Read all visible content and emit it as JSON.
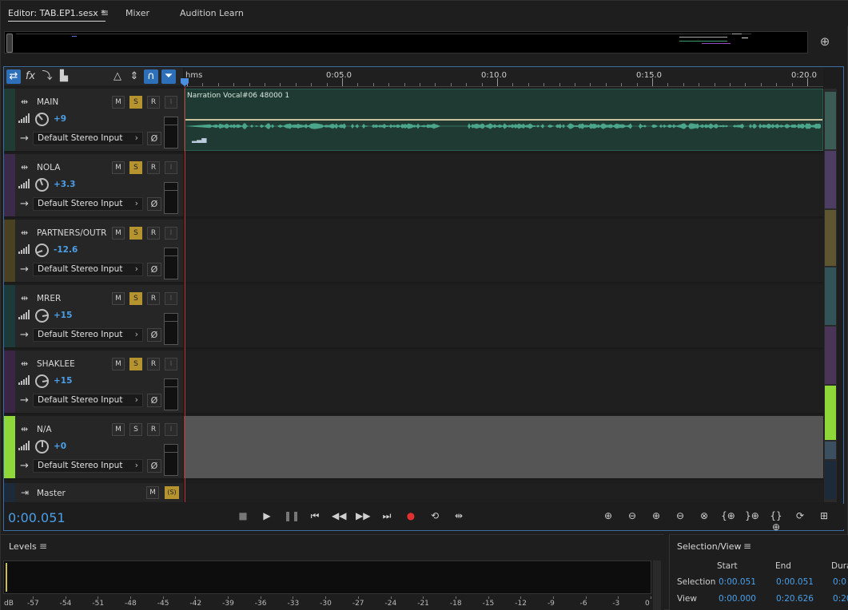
{
  "tabs": {
    "editor": "Editor: TAB.EP1.sesx *",
    "mixer": "Mixer",
    "learn": "Audition Learn"
  },
  "ruler": {
    "unit": "hms",
    "labels": [
      "0:05.0",
      "0:10.0",
      "0:15.0",
      "0:20.0"
    ]
  },
  "clip": {
    "title": "Narration Vocal#06 48000 1"
  },
  "tracks": [
    {
      "name": "MAIN",
      "volume": "+9",
      "input": "Default Stereo Input",
      "color": "#1f3b34",
      "solo": true,
      "knob_deg": -40
    },
    {
      "name": "NOLA",
      "volume": "+3.3",
      "input": "Default Stereo Input",
      "color": "#3b2a4a",
      "solo": true,
      "knob_deg": -20
    },
    {
      "name": "PARTNERS/OUTR",
      "volume": "-12.6",
      "input": "Default Stereo Input",
      "color": "#4a4120",
      "solo": true,
      "knob_deg": -110
    },
    {
      "name": "MRER",
      "volume": "+15",
      "input": "Default Stereo Input",
      "color": "#1d3a3a",
      "solo": true,
      "knob_deg": 80
    },
    {
      "name": "SHAKLEE",
      "volume": "+15",
      "input": "Default Stereo Input",
      "color": "#3b2545",
      "solo": true,
      "knob_deg": 80
    },
    {
      "name": "N/A",
      "volume": "+0",
      "input": "Default Stereo Input",
      "color": "#8fd83a",
      "solo": false,
      "knob_deg": 0
    }
  ],
  "track_buttons": {
    "mute": "M",
    "solo": "S",
    "record": "R",
    "input_monitor": "I"
  },
  "master": {
    "name": "Master",
    "mute": "M",
    "solo": "(S)"
  },
  "transport": {
    "time": "0:00.051"
  },
  "levels": {
    "title": "Levels",
    "unit": "dB",
    "scale": [
      "-57",
      "-54",
      "-51",
      "-48",
      "-45",
      "-42",
      "-39",
      "-36",
      "-33",
      "-30",
      "-27",
      "-24",
      "-21",
      "-18",
      "-15",
      "-12",
      "-9",
      "-6",
      "-3",
      "0"
    ]
  },
  "selection_view": {
    "title": "Selection/View",
    "headers": [
      "Start",
      "End",
      "Dura"
    ],
    "rows": [
      {
        "label": "Selection",
        "start": "0:00.051",
        "end": "0:00.051",
        "duration": "0:0"
      },
      {
        "label": "View",
        "start": "0:00.000",
        "end": "0:20.626",
        "duration": "0:20"
      }
    ]
  },
  "colors": {
    "accent": "#4a9fe8",
    "solo": "#b5932f",
    "playhead": "#c03030",
    "clip": "#1e3a33"
  }
}
